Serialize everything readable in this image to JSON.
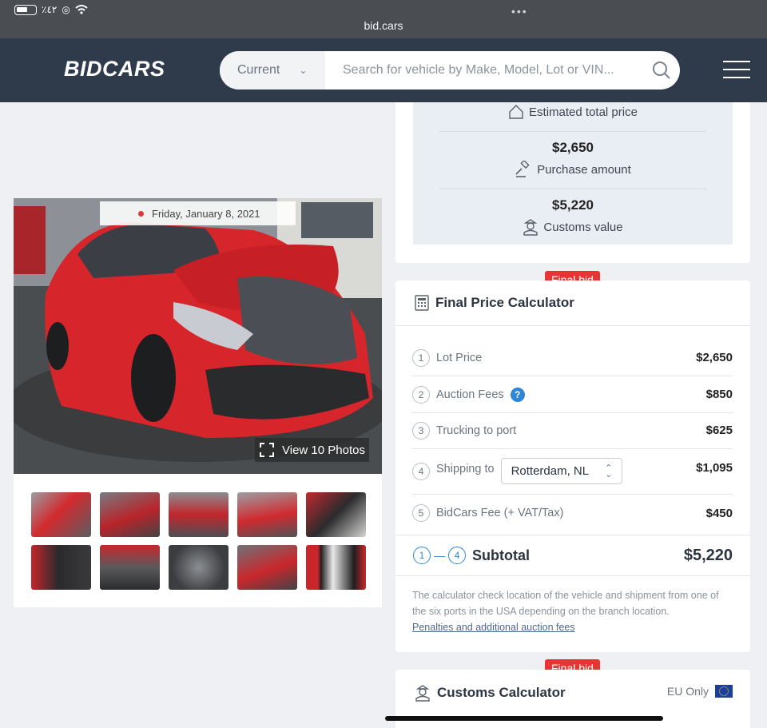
{
  "browser": {
    "url": "bid.cars",
    "status_text": "٪٤٢"
  },
  "header": {
    "logo": "BIDCARS",
    "search_select": "Current",
    "search_placeholder": "Search for vehicle by Make, Model, Lot or VIN..."
  },
  "photos": {
    "date": "Friday, January 8, 2021",
    "view_label": "View 10 Photos",
    "thumbnail_count": 10
  },
  "estimates": {
    "title": "Estimated total price",
    "purchase_amount": "$2,650",
    "purchase_label": "Purchase amount",
    "customs_amount": "$5,220",
    "customs_label": "Customs value"
  },
  "calculator": {
    "badge": "Final bid",
    "title": "Final Price Calculator",
    "rows": [
      {
        "num": "1",
        "label": "Lot Price",
        "value": "$2,650"
      },
      {
        "num": "2",
        "label": "Auction Fees",
        "value": "$850"
      },
      {
        "num": "3",
        "label": "Trucking to port",
        "value": "$625"
      },
      {
        "num": "4",
        "label": "Shipping to",
        "value": "$1,095",
        "select": "Rotterdam, NL"
      },
      {
        "num": "5",
        "label": "BidCars Fee (+ VAT/Tax)",
        "value": "$450"
      }
    ],
    "subtotal": {
      "from": "1",
      "to": "4",
      "label": "Subtotal",
      "value": "$5,220"
    },
    "note": "The calculator check location of the vehicle and shipment from one of the six ports in the USA depending on the branch location.",
    "link": "Penalties and additional auction fees"
  },
  "customs": {
    "badge": "Final bid",
    "title": "Customs Calculator",
    "eu_label": "EU Only"
  },
  "colors": {
    "header": "#2f3b4b",
    "badge": "#e63535",
    "accent": "#2f86d6",
    "car": "#d6262b"
  }
}
